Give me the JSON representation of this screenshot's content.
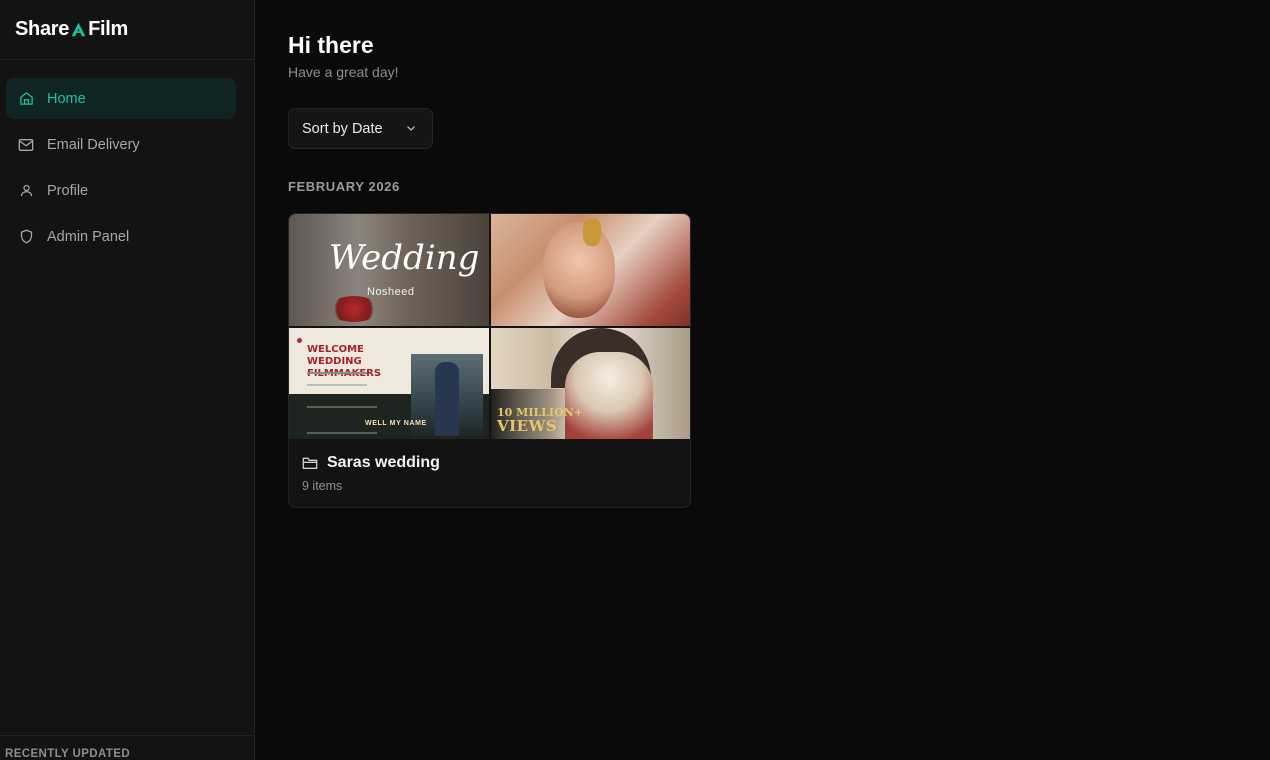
{
  "brand": {
    "name_left": "Share",
    "name_right": "Film",
    "logo_icon": "triangle-a-logo-icon",
    "accent": "#19c3a3"
  },
  "sidebar": {
    "items": [
      {
        "label": "Home",
        "icon": "home-icon",
        "active": true
      },
      {
        "label": "Email Delivery",
        "icon": "mail-icon",
        "active": false
      },
      {
        "label": "Profile",
        "icon": "user-icon",
        "active": false
      },
      {
        "label": "Admin Panel",
        "icon": "shield-icon",
        "active": false
      }
    ],
    "recent_header": "RECENTLY UPDATED"
  },
  "main": {
    "greeting": "Hi there",
    "subgreeting": "Have a great day!",
    "sort_label": "Sort by Date",
    "month_header": "FEBRUARY 2026",
    "folders": [
      {
        "name": "Saras wedding",
        "count": "9 items",
        "icon": "folder-icon",
        "thumb_text": {
          "wedding_title": "Wedding",
          "wedding_sub": "Nosheed",
          "slide_title": "WELCOME WEDDING FILMMAKERS",
          "slide_badge": "WELL MY NAME",
          "views_top": "10 MILLION+",
          "views_bottom": "VIEWS"
        }
      }
    ]
  }
}
